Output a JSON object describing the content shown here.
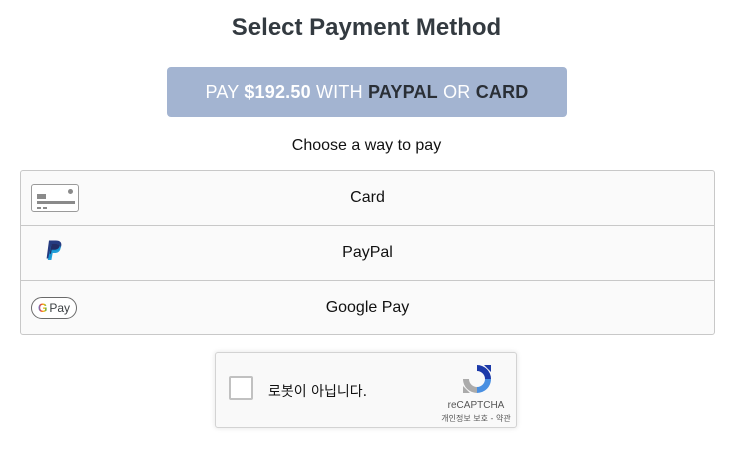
{
  "page": {
    "title": "Select Payment Method"
  },
  "pay_button": {
    "prefix": "PAY ",
    "amount": "$192.50",
    "with": " WITH ",
    "paypal": "PAYPAL",
    "or": " OR ",
    "card": "CARD",
    "color": "#a3b4d1"
  },
  "choose_text": "Choose a way to pay",
  "methods": [
    {
      "label": "Card",
      "icon": "credit-card-icon"
    },
    {
      "label": "PayPal",
      "icon": "paypal-icon"
    },
    {
      "label": "Google Pay",
      "icon": "google-pay-icon"
    }
  ],
  "google_pay_badge": {
    "g": "G",
    "pay": "Pay"
  },
  "recaptcha": {
    "label": "로봇이 아닙니다.",
    "brand": "reCAPTCHA",
    "privacy": "개인정보 보호",
    "separator": " - ",
    "terms": "약관"
  }
}
